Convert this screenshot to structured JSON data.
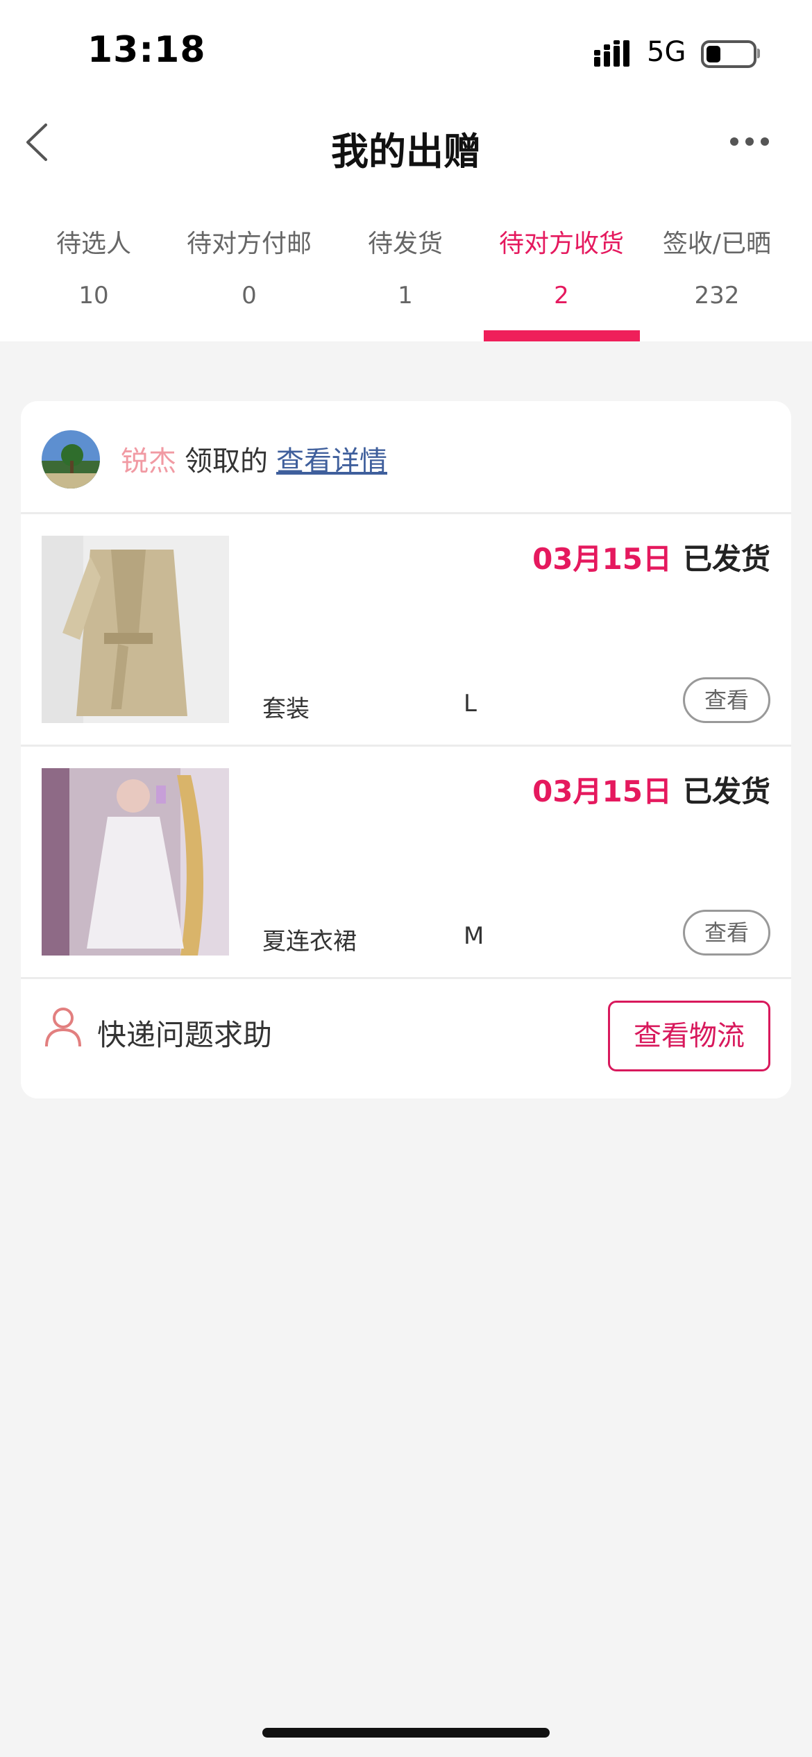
{
  "status_bar": {
    "time": "13:18",
    "network": "5G"
  },
  "header": {
    "title": "我的出赠"
  },
  "tabs": [
    {
      "label": "待选人",
      "count": "10"
    },
    {
      "label": "待对方付邮",
      "count": "0"
    },
    {
      "label": "待发货",
      "count": "1"
    },
    {
      "label": "待对方收货",
      "count": "2",
      "active": true
    },
    {
      "label": "签收/已晒",
      "count": "232"
    }
  ],
  "order": {
    "receiver_name": "锐杰",
    "receiver_suffix": "领取的",
    "detail_link": "查看详情",
    "items": [
      {
        "date": "03月15日",
        "status": "已发货",
        "name": "套装",
        "size": "L",
        "view_label": "查看"
      },
      {
        "date": "03月15日",
        "status": "已发货",
        "name": "夏连衣裙",
        "size": "M",
        "view_label": "查看"
      }
    ],
    "help_label": "快递问题求助",
    "logistics_label": "查看物流"
  },
  "colors": {
    "accent": "#e5195e",
    "name_pink": "#f19aa3",
    "link_blue": "#3f5f9c"
  },
  "icons": [
    "back-arrow-icon",
    "more-dots-icon",
    "signal-icon",
    "battery-icon",
    "person-icon"
  ]
}
